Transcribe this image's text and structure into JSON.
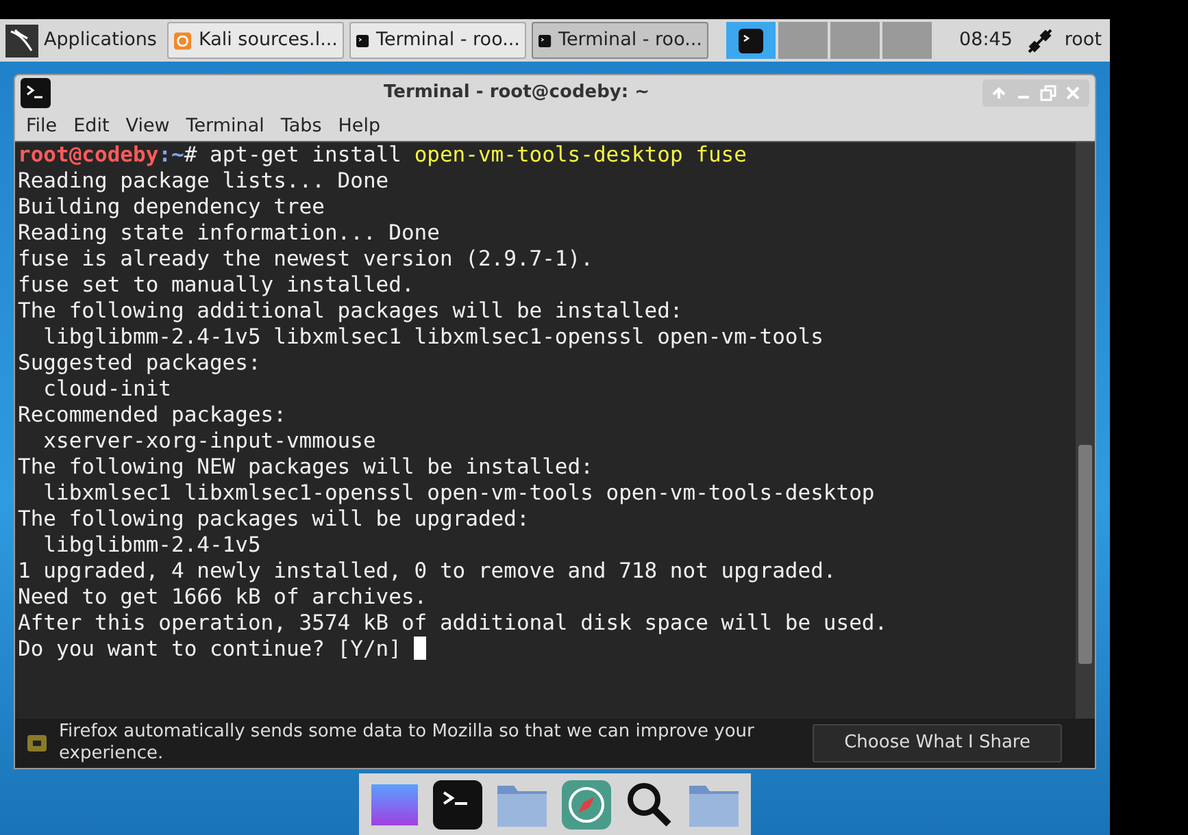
{
  "panel": {
    "applications": "Applications",
    "tasks": [
      {
        "label": "Kali sources.l...",
        "kind": "browser",
        "selected": false
      },
      {
        "label": "Terminal - roo...",
        "kind": "terminal",
        "selected": false
      },
      {
        "label": "Terminal - roo...",
        "kind": "terminal",
        "selected": true
      }
    ],
    "workspaces": [
      {
        "selected": true
      },
      {
        "selected": false
      },
      {
        "selected": false
      },
      {
        "selected": false
      }
    ],
    "clock": "08:45",
    "user": "root"
  },
  "window": {
    "title": "Terminal - root@codeby: ~",
    "menu": [
      "File",
      "Edit",
      "View",
      "Terminal",
      "Tabs",
      "Help"
    ],
    "prompt": {
      "user_host": "root@codeby",
      "path": ":~",
      "symbol": "# ",
      "command": "apt-get install ",
      "args": "open-vm-tools-desktop fuse"
    },
    "output": [
      "Reading package lists... Done",
      "Building dependency tree",
      "Reading state information... Done",
      "fuse is already the newest version (2.9.7-1).",
      "fuse set to manually installed.",
      "The following additional packages will be installed:",
      "  libglibmm-2.4-1v5 libxmlsec1 libxmlsec1-openssl open-vm-tools",
      "Suggested packages:",
      "  cloud-init",
      "Recommended packages:",
      "  xserver-xorg-input-vmmouse",
      "The following NEW packages will be installed:",
      "  libxmlsec1 libxmlsec1-openssl open-vm-tools open-vm-tools-desktop",
      "The following packages will be upgraded:",
      "  libglibmm-2.4-1v5",
      "1 upgraded, 4 newly installed, 0 to remove and 718 not upgraded.",
      "Need to get 1666 kB of archives.",
      "After this operation, 3574 kB of additional disk space will be used.",
      "Do you want to continue? [Y/n] "
    ]
  },
  "notification": {
    "text": "Firefox automatically sends some data to Mozilla so that we can improve your experience.",
    "button": "Choose What I Share"
  }
}
